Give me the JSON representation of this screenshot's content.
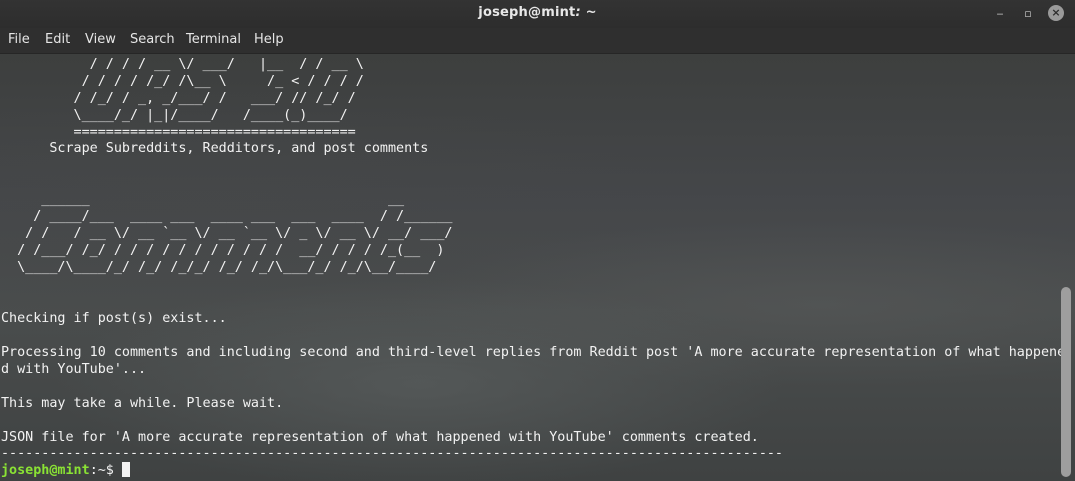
{
  "window": {
    "title_user": "joseph@mint",
    "title_sep": ": ~",
    "buttons": {
      "minimize": "‒",
      "maximize": "▫",
      "close": "×"
    }
  },
  "menu": [
    "File",
    "Edit",
    "View",
    "Search",
    "Terminal",
    "Help"
  ],
  "banner_top": [
    "           / / / / __ \\/ ___/   |__  / / __ \\",
    "          / / / / /_/ /\\__ \\     /_ < / / / /",
    "         / /_/ / _, _/___/ /   ___/ // /_/ /",
    "         \\____/_/ |_|/____/   /____(_)____/",
    "         ===================================",
    "      Scrape Subreddits, Redditors, and post comments"
  ],
  "banner_comments": [
    "     ______                                     __",
    "    / ____/___  ____ ___  ____ ___  ___  ____  / /______",
    "   / /   / __ \\/ __ `__ \\/ __ `__ \\/ _ \\/ __ \\/ __/ ___/",
    "  / /___/ /_/ / / / / / / / / / / /  __/ / / / /_(__  )",
    "  \\____/\\____/_/ /_/ /_/_/ /_/ /_/\\___/_/ /_/\\__/____/"
  ],
  "output": [
    "Checking if post(s) exist...",
    "",
    "Processing 10 comments and including second and third-level replies from Reddit post 'A more accurate representation of what happene",
    "d with YouTube'...",
    "",
    "This may take a while. Please wait.",
    "",
    "JSON file for 'A more accurate representation of what happened with YouTube' comments created.",
    "-------------------------------------------------------------------------------------------------"
  ],
  "prompt": {
    "user_host": "joseph@mint",
    "path": ":~$ "
  }
}
